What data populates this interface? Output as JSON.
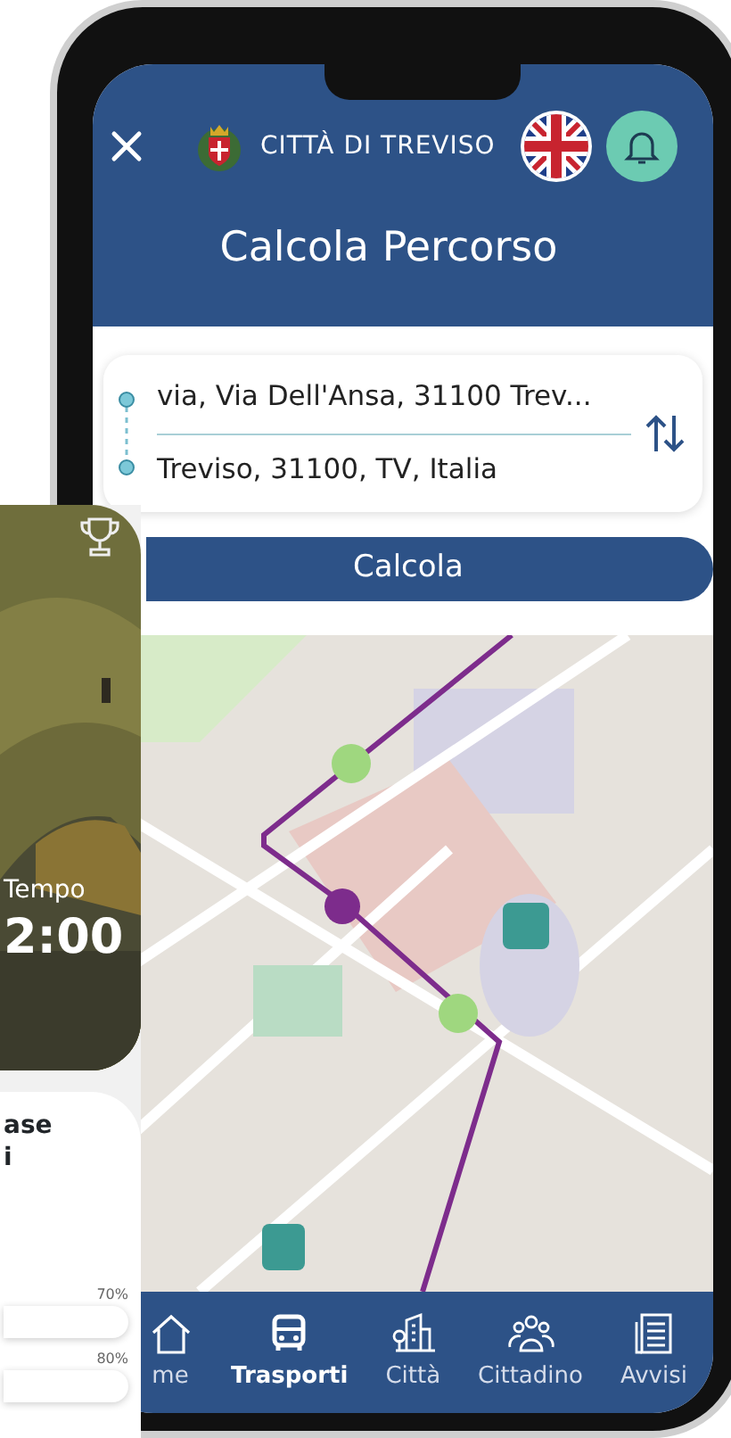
{
  "side_screen": {
    "time_label": "Tempo",
    "time_value": "2:00",
    "card_lines": [
      "ase",
      "i"
    ],
    "bar_labels": [
      "70%",
      "80%"
    ]
  },
  "header": {
    "city": "CITTÀ DI TREVISO",
    "title": "Calcola Percorso"
  },
  "route": {
    "origin": "via, Via Dell'Ansa, 31100 Trev...",
    "destination": "Treviso, 31100, TV, Italia"
  },
  "calculate_button": "Calcola",
  "tabs": [
    {
      "label": "me",
      "kind": "home",
      "selected": false
    },
    {
      "label": "Trasporti",
      "kind": "bus",
      "selected": true
    },
    {
      "label": "Città",
      "kind": "city",
      "selected": false
    },
    {
      "label": "Cittadino",
      "kind": "people",
      "selected": false
    },
    {
      "label": "Avvisi",
      "kind": "news",
      "selected": false
    }
  ]
}
